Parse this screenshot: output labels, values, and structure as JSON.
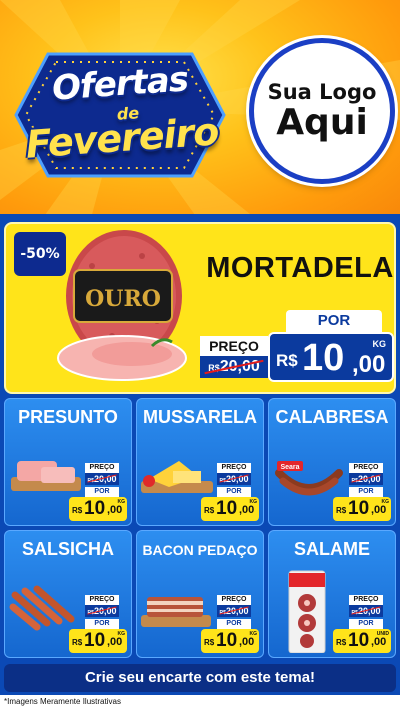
{
  "header": {
    "title_line1": "Ofertas",
    "title_line2": "de",
    "title_line3": "Fevereiro",
    "logo_line1": "Sua Logo",
    "logo_line2": "Aqui"
  },
  "hero": {
    "discount": "-50%",
    "product": "MORTADELA",
    "brand": "OURO",
    "preco_label": "PREÇO",
    "old_currency": "R$",
    "old_price": "20,00",
    "por_label": "POR",
    "currency": "R$",
    "price_int": "10",
    "price_dec": ",00",
    "unit": "KG"
  },
  "products": [
    {
      "name": "PRESUNTO",
      "preco_label": "PREÇO",
      "old_currency": "R$",
      "old_price": "20,00",
      "por_label": "POR",
      "currency": "R$",
      "price_int": "10",
      "price_dec": ",00",
      "unit": "KG"
    },
    {
      "name": "MUSSARELA",
      "preco_label": "PREÇO",
      "old_currency": "R$",
      "old_price": "20,00",
      "por_label": "POR",
      "currency": "R$",
      "price_int": "10",
      "price_dec": ",00",
      "unit": "KG"
    },
    {
      "name": "CALABRESA",
      "preco_label": "PREÇO",
      "old_currency": "R$",
      "old_price": "20,00",
      "por_label": "POR",
      "currency": "R$",
      "price_int": "10",
      "price_dec": ",00",
      "unit": "KG",
      "brand": "Seara"
    },
    {
      "name": "SALSICHA",
      "preco_label": "PREÇO",
      "old_currency": "R$",
      "old_price": "20,00",
      "por_label": "POR",
      "currency": "R$",
      "price_int": "10",
      "price_dec": ",00",
      "unit": "KG"
    },
    {
      "name": "BACON PEDAÇO",
      "preco_label": "PREÇO",
      "old_currency": "R$",
      "old_price": "20,00",
      "por_label": "POR",
      "currency": "R$",
      "price_int": "10",
      "price_dec": ",00",
      "unit": "KG"
    },
    {
      "name": "SALAME",
      "preco_label": "PREÇO",
      "old_currency": "R$",
      "old_price": "20,00",
      "por_label": "POR",
      "currency": "R$",
      "price_int": "10",
      "price_dec": ",00",
      "unit": "UNID"
    }
  ],
  "footer": {
    "cta": "Crie seu encarte com este tema!",
    "disclaimer": "*Imagens Meramente Ilustrativas"
  },
  "colors": {
    "header_orange": "#ff9b0c",
    "body_blue": "#0b49b5",
    "hero_yellow": "#ffe41a",
    "price_blue": "#0b3a9e",
    "card_blue": "#1d7ae0",
    "strike_red": "#e31b1b"
  }
}
